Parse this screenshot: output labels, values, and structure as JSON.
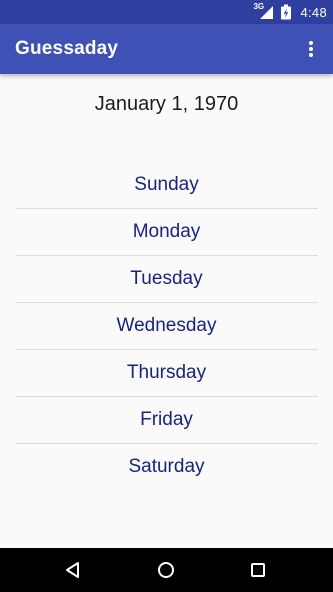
{
  "status_bar": {
    "network_label": "3G",
    "time": "4:48",
    "icons": [
      "signal-icon",
      "battery-icon"
    ]
  },
  "app_bar": {
    "title": "Guessaday",
    "menu_icon": "more-vert-icon"
  },
  "main": {
    "date": "January 1, 1970",
    "days": [
      "Sunday",
      "Monday",
      "Tuesday",
      "Wednesday",
      "Thursday",
      "Friday",
      "Saturday"
    ]
  },
  "nav_bar": {
    "icons": [
      "back-icon",
      "home-icon",
      "recents-icon"
    ]
  },
  "colors": {
    "status_bar": "#303f9f",
    "app_bar": "#3f51b5",
    "day_text": "#1a237e",
    "background": "#fafafa"
  }
}
